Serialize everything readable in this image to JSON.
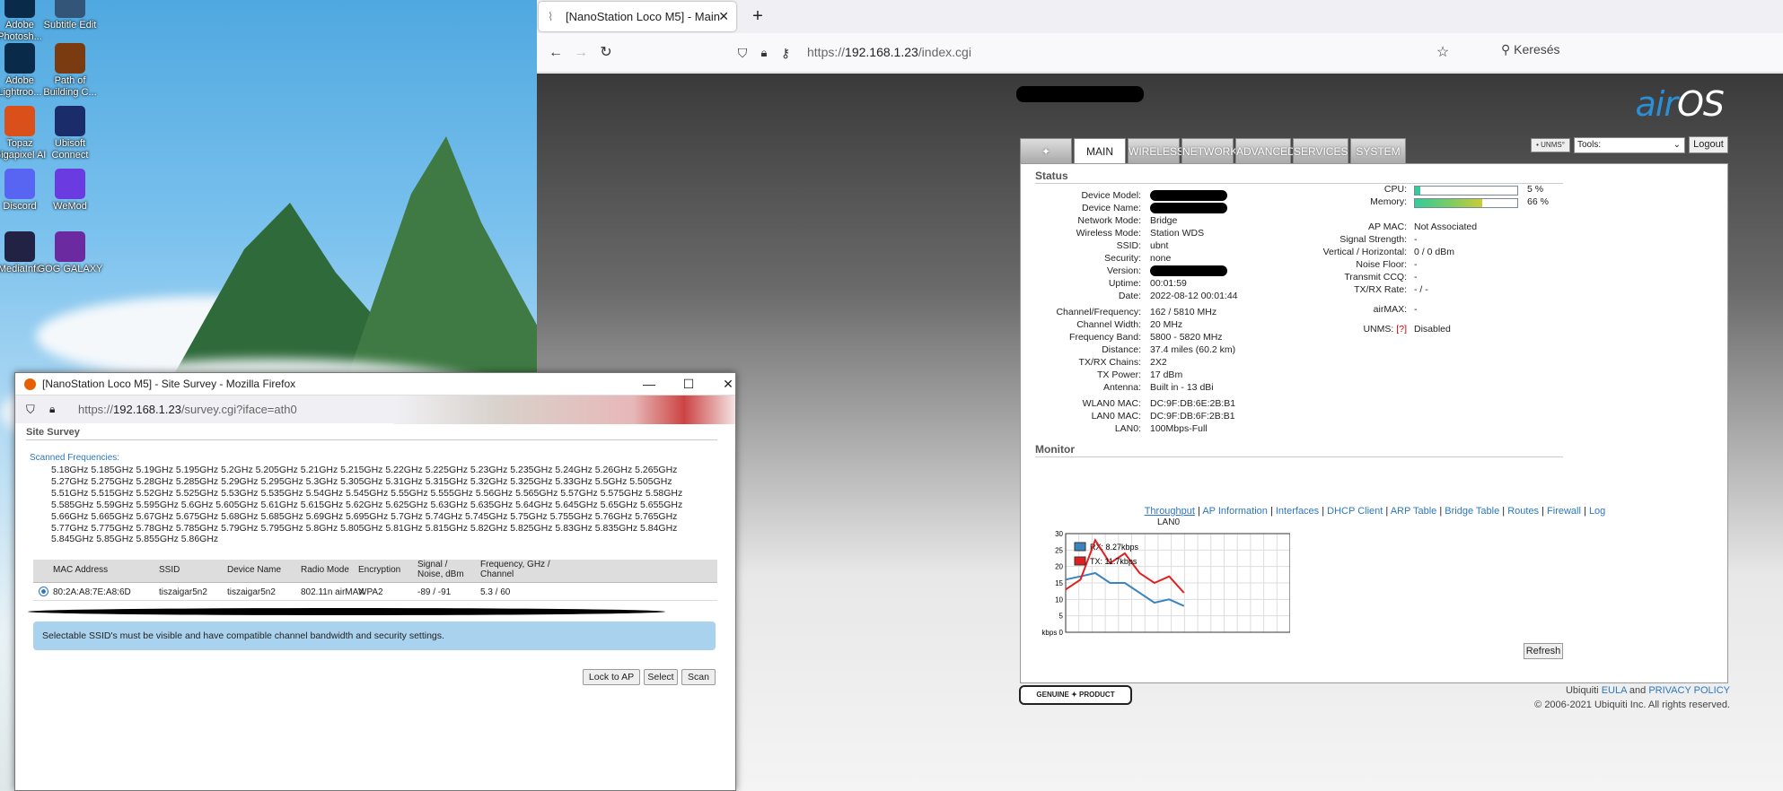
{
  "desktop": {
    "icons": [
      {
        "label": "Adobe\nPhotosh...",
        "name": "adobe-photoshop-icon",
        "color": "#0a2a4a"
      },
      {
        "label": "Subtitle Edit",
        "name": "subtitle-edit-icon",
        "color": "#335577"
      },
      {
        "label": "Adobe\nLightroo...",
        "name": "adobe-lightroom-icon",
        "color": "#0a2a4a"
      },
      {
        "label": "Path of\nBuilding C...",
        "name": "path-of-building-icon",
        "color": "#7a3b10"
      },
      {
        "label": "Topaz\nGigapixel AI",
        "name": "topaz-gigapixel-icon",
        "color": "#d9501a"
      },
      {
        "label": "Ubisoft\nConnect",
        "name": "ubisoft-connect-icon",
        "color": "#1b2c6b"
      },
      {
        "label": "Discord",
        "name": "discord-icon",
        "color": "#5865f2"
      },
      {
        "label": "WeMod",
        "name": "wemod-icon",
        "color": "#6a3be0"
      },
      {
        "label": "MediaInfo",
        "name": "mediainfo-icon",
        "color": "#222244"
      },
      {
        "label": "GOG GALAXY",
        "name": "gog-galaxy-icon",
        "color": "#6b2aa0"
      }
    ]
  },
  "browser": {
    "tab_title": "[NanoStation Loco M5] - Main",
    "url_prefix": "https://",
    "url_host": "192.168.1.23",
    "url_path": "/index.cgi",
    "search_placeholder": "Keresés"
  },
  "airos": {
    "logo_air": "air",
    "logo_os": "OS",
    "tabs": [
      "MAIN",
      "WIRELESS",
      "NETWORK",
      "ADVANCED",
      "SERVICES",
      "SYSTEM"
    ],
    "unms_badge": "• UNMS°",
    "tools_label": "Tools:",
    "logout": "Logout",
    "status_title": "Status",
    "left_status": [
      {
        "k": "Device Model:",
        "v": ""
      },
      {
        "k": "Device Name:",
        "v": ""
      },
      {
        "k": "Network Mode:",
        "v": "Bridge"
      },
      {
        "k": "Wireless Mode:",
        "v": "Station WDS"
      },
      {
        "k": "SSID:",
        "v": "ubnt"
      },
      {
        "k": "Security:",
        "v": "none"
      },
      {
        "k": "Version:",
        "v": ""
      },
      {
        "k": "Uptime:",
        "v": "00:01:59"
      },
      {
        "k": "Date:",
        "v": "2022-08-12 00:01:44"
      },
      {
        "k": "Channel/Frequency:",
        "v": "162 / 5810 MHz"
      },
      {
        "k": "Channel Width:",
        "v": "20 MHz"
      },
      {
        "k": "Frequency Band:",
        "v": "5800 - 5820 MHz"
      },
      {
        "k": "Distance:",
        "v": "37.4 miles (60.2 km)"
      },
      {
        "k": "TX/RX Chains:",
        "v": "2X2"
      },
      {
        "k": "TX Power:",
        "v": "17 dBm"
      },
      {
        "k": "Antenna:",
        "v": "Built in - 13 dBi"
      },
      {
        "k": "WLAN0 MAC:",
        "v": "DC:9F:DB:6E:2B:B1"
      },
      {
        "k": "LAN0 MAC:",
        "v": "DC:9F:DB:6F:2B:B1"
      },
      {
        "k": "LAN0:",
        "v": "100Mbps-Full"
      }
    ],
    "cpu_label": "CPU:",
    "cpu_value": "5 %",
    "cpu_pct": 5,
    "mem_label": "Memory:",
    "mem_value": "66 %",
    "mem_pct": 66,
    "right_status": [
      {
        "k": "AP MAC:",
        "v": "Not Associated"
      },
      {
        "k": "Signal Strength:",
        "v": "-"
      },
      {
        "k": "Vertical / Horizontal:",
        "v": "0 / 0 dBm"
      },
      {
        "k": "Noise Floor:",
        "v": "-"
      },
      {
        "k": "Transmit CCQ:",
        "v": "-"
      },
      {
        "k": "TX/RX Rate:",
        "v": "- / -"
      },
      {
        "k": "airMAX:",
        "v": "-"
      },
      {
        "k": "UNMS:",
        "k2": "[?]",
        "v": "Disabled"
      }
    ],
    "monitor_title": "Monitor",
    "monitor_links": [
      "Throughput",
      "AP Information",
      "Interfaces",
      "DHCP Client",
      "ARP Table",
      "Bridge Table",
      "Routes",
      "Firewall",
      "Log"
    ],
    "chart_title": "LAN0",
    "refresh": "Refresh",
    "genuine": "GENUINE ✦ PRODUCT",
    "footer_company": "Ubiquiti",
    "footer_eula": "EULA",
    "footer_and": "and",
    "footer_privacy": "PRIVACY POLICY",
    "copyright": "© 2006-2021 Ubiquiti Inc. All rights reserved."
  },
  "chart_data": {
    "type": "line",
    "title": "LAN0",
    "ylabel": "kbps",
    "yticks": [
      0,
      5,
      10,
      15,
      20,
      25,
      30
    ],
    "ylim": [
      0,
      30
    ],
    "x": [
      0,
      1,
      2,
      3,
      4,
      5,
      6,
      7,
      8
    ],
    "series": [
      {
        "name": "RX: 8.27kbps",
        "color": "#3a85c0",
        "values": [
          16,
          17,
          18,
          15,
          15,
          12,
          9,
          10,
          8
        ]
      },
      {
        "name": "TX: 11.7kbps",
        "color": "#e02020",
        "values": [
          13,
          16,
          28,
          21,
          24,
          18,
          15,
          17,
          12
        ]
      }
    ]
  },
  "survey": {
    "window_title": "[NanoStation Loco M5] - Site Survey - Mozilla Firefox",
    "url_host": "192.168.1.23",
    "url_prefix": "https://",
    "url_path": "/survey.cgi?iface=ath0",
    "section": "Site Survey",
    "scanned_label": "Scanned Frequencies:",
    "frequencies": "5.18GHz 5.185GHz 5.19GHz 5.195GHz 5.2GHz 5.205GHz 5.21GHz 5.215GHz 5.22GHz 5.225GHz 5.23GHz 5.235GHz 5.24GHz 5.26GHz 5.265GHz\n5.27GHz 5.275GHz 5.28GHz 5.285GHz 5.29GHz 5.295GHz 5.3GHz 5.305GHz 5.31GHz 5.315GHz 5.32GHz 5.325GHz 5.33GHz 5.5GHz 5.505GHz\n5.51GHz 5.515GHz 5.52GHz 5.525GHz 5.53GHz 5.535GHz 5.54GHz 5.545GHz 5.55GHz 5.555GHz 5.56GHz 5.565GHz 5.57GHz 5.575GHz 5.58GHz\n5.585GHz 5.59GHz 5.595GHz 5.6GHz 5.605GHz 5.61GHz 5.615GHz 5.62GHz 5.625GHz 5.63GHz 5.635GHz 5.64GHz 5.645GHz 5.65GHz 5.655GHz\n5.66GHz 5.665GHz 5.67GHz 5.675GHz 5.68GHz 5.685GHz 5.69GHz 5.695GHz 5.7GHz 5.74GHz 5.745GHz 5.75GHz 5.755GHz 5.76GHz 5.765GHz\n5.77GHz 5.775GHz 5.78GHz 5.785GHz 5.79GHz 5.795GHz 5.8GHz 5.805GHz 5.81GHz 5.815GHz 5.82GHz 5.825GHz 5.83GHz 5.835GHz 5.84GHz\n5.845GHz 5.85GHz 5.855GHz 5.86GHz",
    "headers": [
      "MAC Address",
      "SSID",
      "Device Name",
      "Radio Mode",
      "Encryption",
      "Signal /\nNoise, dBm",
      "Frequency, GHz /\nChannel"
    ],
    "rows": [
      [
        "80:2A:A8:7E:A8:6D",
        "tiszaigar5n2",
        "tiszaigar5n2",
        "802.11n airMAX",
        "WPA2",
        "-89 / -91",
        "5.3 / 60"
      ]
    ],
    "note": "Selectable SSID's must be visible and have compatible channel bandwidth and security settings.",
    "buttons": [
      "Lock to AP",
      "Select",
      "Scan"
    ]
  }
}
